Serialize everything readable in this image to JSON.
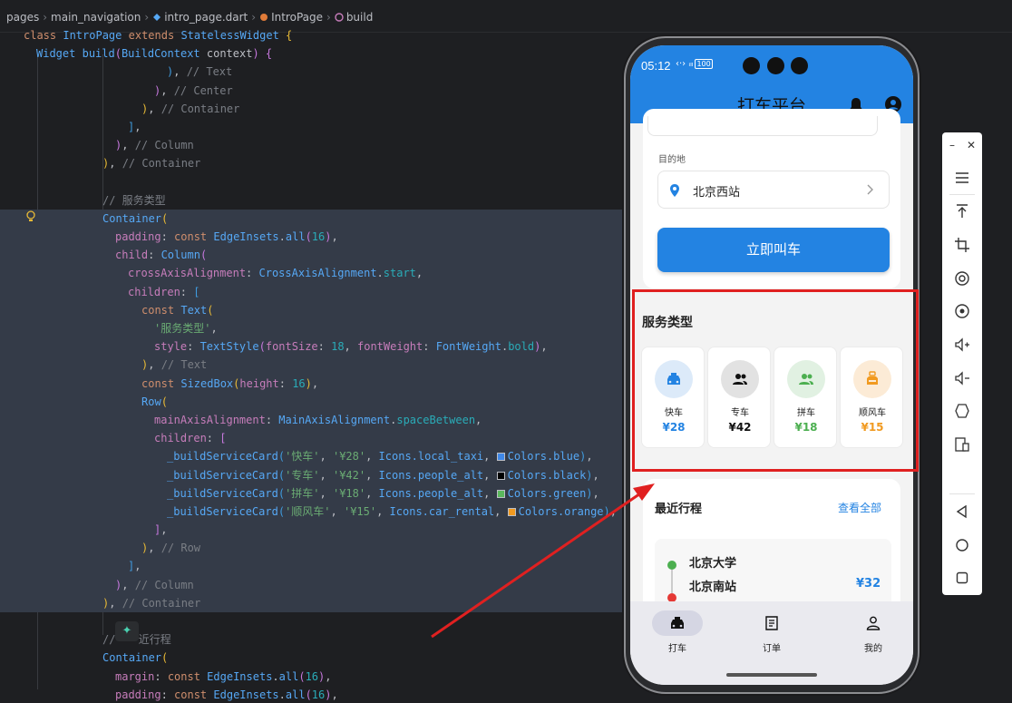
{
  "breadcrumb": {
    "items": [
      "pages",
      "main_navigation",
      "intro_page.dart",
      "IntroPage",
      "build"
    ]
  },
  "code": {
    "line_numbers": [
      "",
      "",
      "",
      "",
      "",
      "",
      "",
      "",
      "",
      "",
      "",
      "",
      "",
      "",
      "",
      "",
      "",
      "",
      "",
      "",
      "",
      "",
      "",
      "",
      "",
      "",
      "",
      "",
      "",
      "",
      "",
      "",
      "",
      "",
      "",
      "",
      "",
      "",
      ""
    ],
    "comments": {
      "service_type": "// 服务类型",
      "recent_trips_tail": "近行程"
    },
    "strings": {
      "service_title": "'服务类型'",
      "cards": [
        {
          "name": "'快车'",
          "price": "'¥28'",
          "icon": "Icons.local_taxi",
          "color": "Colors.blue",
          "swatch": "#3f88e8"
        },
        {
          "name": "'专车'",
          "price": "'¥42'",
          "icon": "Icons.people_alt",
          "color": "Colors.black",
          "swatch": "#000000"
        },
        {
          "name": "'拼车'",
          "price": "'¥18'",
          "icon": "Icons.people_alt",
          "color": "Colors.green",
          "swatch": "#5bb85c"
        },
        {
          "name": "'顺风车'",
          "price": "'¥15'",
          "icon": "Icons.car_rental",
          "color": "Colors.orange",
          "swatch": "#f19a20"
        }
      ]
    },
    "numbers": {
      "padding": "16",
      "font_size": "18",
      "height": "16"
    }
  },
  "phone": {
    "status": {
      "time": "05:12",
      "battery": "100"
    },
    "app_title": "打车平台",
    "destination_label": "目的地",
    "destination_value": "北京西站",
    "call_button": "立即叫车",
    "service_title": "服务类型",
    "services": [
      {
        "name": "快车",
        "price": "¥28",
        "color": "#2383e2",
        "bg": "#dceaf9"
      },
      {
        "name": "专车",
        "price": "¥42",
        "color": "#111111",
        "bg": "#e2e2e2"
      },
      {
        "name": "拼车",
        "price": "¥18",
        "color": "#4caf50",
        "bg": "#e1f1e2"
      },
      {
        "name": "顺风车",
        "price": "¥15",
        "color": "#f19a20",
        "bg": "#fcebd6"
      }
    ],
    "recent_title": "最近行程",
    "view_all": "查看全部",
    "trip": {
      "from": "北京大学",
      "to": "北京南站",
      "price": "¥32"
    },
    "nav": [
      {
        "label": "打车",
        "icon": "taxi-icon",
        "active": true
      },
      {
        "label": "订单",
        "icon": "receipt-icon",
        "active": false
      },
      {
        "label": "我的",
        "icon": "person-icon",
        "active": false
      }
    ]
  },
  "colors": {
    "primary": "#2383e2",
    "highlight": "#e02020"
  }
}
